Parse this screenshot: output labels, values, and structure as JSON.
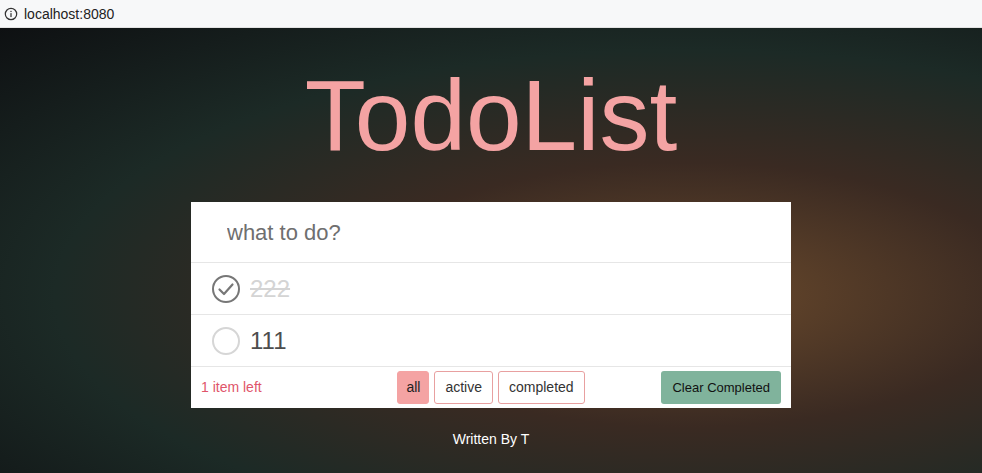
{
  "browser": {
    "url": "localhost:8080"
  },
  "title": "TodoList",
  "input": {
    "placeholder": "what to do?"
  },
  "todos": [
    {
      "text": "222",
      "completed": true
    },
    {
      "text": "111",
      "completed": false
    }
  ],
  "footer": {
    "items_left": "1 item left",
    "filters": [
      {
        "label": "all",
        "selected": true
      },
      {
        "label": "active",
        "selected": false
      },
      {
        "label": "completed",
        "selected": false
      }
    ],
    "clear_button": "Clear Completed"
  },
  "credit": "Written By T"
}
